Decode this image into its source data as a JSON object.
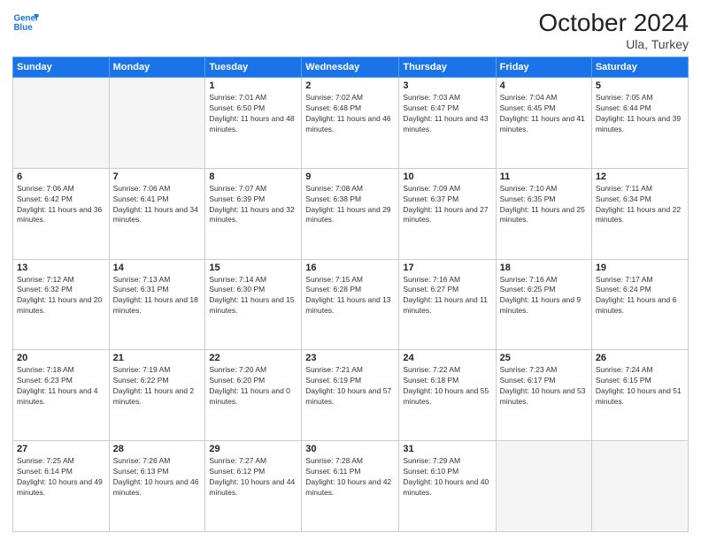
{
  "header": {
    "logo_line1": "General",
    "logo_line2": "Blue",
    "month_title": "October 2024",
    "location": "Ula, Turkey"
  },
  "weekdays": [
    "Sunday",
    "Monday",
    "Tuesday",
    "Wednesday",
    "Thursday",
    "Friday",
    "Saturday"
  ],
  "weeks": [
    [
      {
        "day": "",
        "empty": true
      },
      {
        "day": "",
        "empty": true
      },
      {
        "day": "1",
        "sunrise": "Sunrise: 7:01 AM",
        "sunset": "Sunset: 6:50 PM",
        "daylight": "Daylight: 11 hours and 48 minutes."
      },
      {
        "day": "2",
        "sunrise": "Sunrise: 7:02 AM",
        "sunset": "Sunset: 6:48 PM",
        "daylight": "Daylight: 11 hours and 46 minutes."
      },
      {
        "day": "3",
        "sunrise": "Sunrise: 7:03 AM",
        "sunset": "Sunset: 6:47 PM",
        "daylight": "Daylight: 11 hours and 43 minutes."
      },
      {
        "day": "4",
        "sunrise": "Sunrise: 7:04 AM",
        "sunset": "Sunset: 6:45 PM",
        "daylight": "Daylight: 11 hours and 41 minutes."
      },
      {
        "day": "5",
        "sunrise": "Sunrise: 7:05 AM",
        "sunset": "Sunset: 6:44 PM",
        "daylight": "Daylight: 11 hours and 39 minutes."
      }
    ],
    [
      {
        "day": "6",
        "sunrise": "Sunrise: 7:06 AM",
        "sunset": "Sunset: 6:42 PM",
        "daylight": "Daylight: 11 hours and 36 minutes."
      },
      {
        "day": "7",
        "sunrise": "Sunrise: 7:06 AM",
        "sunset": "Sunset: 6:41 PM",
        "daylight": "Daylight: 11 hours and 34 minutes."
      },
      {
        "day": "8",
        "sunrise": "Sunrise: 7:07 AM",
        "sunset": "Sunset: 6:39 PM",
        "daylight": "Daylight: 11 hours and 32 minutes."
      },
      {
        "day": "9",
        "sunrise": "Sunrise: 7:08 AM",
        "sunset": "Sunset: 6:38 PM",
        "daylight": "Daylight: 11 hours and 29 minutes."
      },
      {
        "day": "10",
        "sunrise": "Sunrise: 7:09 AM",
        "sunset": "Sunset: 6:37 PM",
        "daylight": "Daylight: 11 hours and 27 minutes."
      },
      {
        "day": "11",
        "sunrise": "Sunrise: 7:10 AM",
        "sunset": "Sunset: 6:35 PM",
        "daylight": "Daylight: 11 hours and 25 minutes."
      },
      {
        "day": "12",
        "sunrise": "Sunrise: 7:11 AM",
        "sunset": "Sunset: 6:34 PM",
        "daylight": "Daylight: 11 hours and 22 minutes."
      }
    ],
    [
      {
        "day": "13",
        "sunrise": "Sunrise: 7:12 AM",
        "sunset": "Sunset: 6:32 PM",
        "daylight": "Daylight: 11 hours and 20 minutes."
      },
      {
        "day": "14",
        "sunrise": "Sunrise: 7:13 AM",
        "sunset": "Sunset: 6:31 PM",
        "daylight": "Daylight: 11 hours and 18 minutes."
      },
      {
        "day": "15",
        "sunrise": "Sunrise: 7:14 AM",
        "sunset": "Sunset: 6:30 PM",
        "daylight": "Daylight: 11 hours and 15 minutes."
      },
      {
        "day": "16",
        "sunrise": "Sunrise: 7:15 AM",
        "sunset": "Sunset: 6:28 PM",
        "daylight": "Daylight: 11 hours and 13 minutes."
      },
      {
        "day": "17",
        "sunrise": "Sunrise: 7:16 AM",
        "sunset": "Sunset: 6:27 PM",
        "daylight": "Daylight: 11 hours and 11 minutes."
      },
      {
        "day": "18",
        "sunrise": "Sunrise: 7:16 AM",
        "sunset": "Sunset: 6:25 PM",
        "daylight": "Daylight: 11 hours and 9 minutes."
      },
      {
        "day": "19",
        "sunrise": "Sunrise: 7:17 AM",
        "sunset": "Sunset: 6:24 PM",
        "daylight": "Daylight: 11 hours and 6 minutes."
      }
    ],
    [
      {
        "day": "20",
        "sunrise": "Sunrise: 7:18 AM",
        "sunset": "Sunset: 6:23 PM",
        "daylight": "Daylight: 11 hours and 4 minutes."
      },
      {
        "day": "21",
        "sunrise": "Sunrise: 7:19 AM",
        "sunset": "Sunset: 6:22 PM",
        "daylight": "Daylight: 11 hours and 2 minutes."
      },
      {
        "day": "22",
        "sunrise": "Sunrise: 7:20 AM",
        "sunset": "Sunset: 6:20 PM",
        "daylight": "Daylight: 11 hours and 0 minutes."
      },
      {
        "day": "23",
        "sunrise": "Sunrise: 7:21 AM",
        "sunset": "Sunset: 6:19 PM",
        "daylight": "Daylight: 10 hours and 57 minutes."
      },
      {
        "day": "24",
        "sunrise": "Sunrise: 7:22 AM",
        "sunset": "Sunset: 6:18 PM",
        "daylight": "Daylight: 10 hours and 55 minutes."
      },
      {
        "day": "25",
        "sunrise": "Sunrise: 7:23 AM",
        "sunset": "Sunset: 6:17 PM",
        "daylight": "Daylight: 10 hours and 53 minutes."
      },
      {
        "day": "26",
        "sunrise": "Sunrise: 7:24 AM",
        "sunset": "Sunset: 6:15 PM",
        "daylight": "Daylight: 10 hours and 51 minutes."
      }
    ],
    [
      {
        "day": "27",
        "sunrise": "Sunrise: 7:25 AM",
        "sunset": "Sunset: 6:14 PM",
        "daylight": "Daylight: 10 hours and 49 minutes."
      },
      {
        "day": "28",
        "sunrise": "Sunrise: 7:26 AM",
        "sunset": "Sunset: 6:13 PM",
        "daylight": "Daylight: 10 hours and 46 minutes."
      },
      {
        "day": "29",
        "sunrise": "Sunrise: 7:27 AM",
        "sunset": "Sunset: 6:12 PM",
        "daylight": "Daylight: 10 hours and 44 minutes."
      },
      {
        "day": "30",
        "sunrise": "Sunrise: 7:28 AM",
        "sunset": "Sunset: 6:11 PM",
        "daylight": "Daylight: 10 hours and 42 minutes."
      },
      {
        "day": "31",
        "sunrise": "Sunrise: 7:29 AM",
        "sunset": "Sunset: 6:10 PM",
        "daylight": "Daylight: 10 hours and 40 minutes."
      },
      {
        "day": "",
        "empty": true
      },
      {
        "day": "",
        "empty": true
      }
    ]
  ]
}
